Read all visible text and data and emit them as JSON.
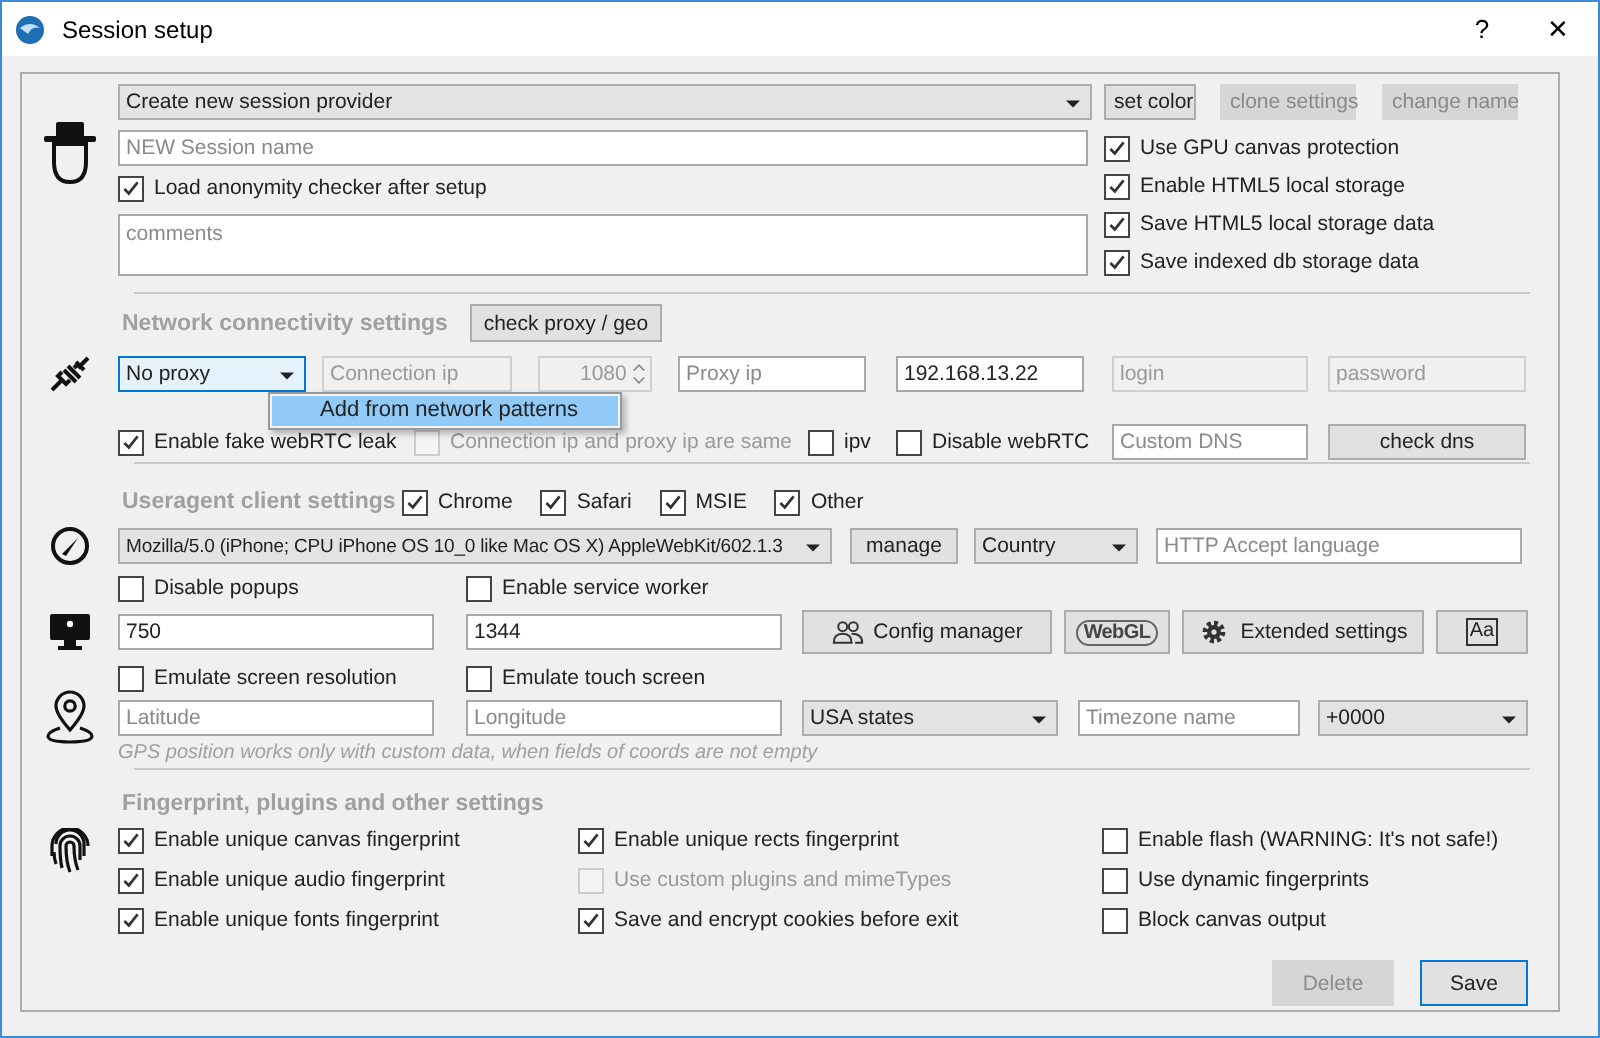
{
  "window": {
    "title": "Session setup",
    "help": "?",
    "close": "✕"
  },
  "session": {
    "provider": {
      "value": "Create new session provider"
    },
    "buttons": [
      {
        "label": "set color",
        "disabled": false
      },
      {
        "label": "clone settings",
        "disabled": true
      },
      {
        "label": "change name",
        "disabled": true
      }
    ],
    "name_field": {
      "placeholder": "NEW Session name"
    },
    "load_checker": {
      "label": "Load anonymity checker after setup",
      "checked": true
    },
    "comments": {
      "placeholder": "comments"
    },
    "options": [
      {
        "label": "Use GPU canvas protection",
        "checked": true
      },
      {
        "label": "Enable HTML5 local storage",
        "checked": true
      },
      {
        "label": "Save HTML5 local storage data",
        "checked": true
      },
      {
        "label": "Save indexed db storage data",
        "checked": true
      }
    ]
  },
  "network": {
    "title": "Network connectivity settings",
    "check_button": "check proxy / geo",
    "proxy_type": {
      "value": "No proxy"
    },
    "menu": [
      {
        "label": "Add from network patterns",
        "selected": true
      }
    ],
    "connection_ip": {
      "placeholder": "Connection ip",
      "disabled": true
    },
    "port": {
      "value": "1080",
      "disabled": true
    },
    "proxy_ip": {
      "placeholder": "Proxy ip"
    },
    "local_ip": {
      "value": "192.168.13.22"
    },
    "login": {
      "placeholder": "login",
      "disabled": true
    },
    "password": {
      "placeholder": "password",
      "disabled": true
    },
    "checks": [
      {
        "label": "Enable fake webRTC leak",
        "checked": true,
        "disabled": false
      },
      {
        "label": "Connection ip and proxy ip are same",
        "checked": false,
        "disabled": true
      },
      {
        "label": "ipv",
        "checked": false,
        "disabled": false
      },
      {
        "label": "Disable webRTC",
        "checked": false,
        "disabled": false
      }
    ],
    "dns": {
      "placeholder": "Custom DNS"
    },
    "check_dns": "check dns"
  },
  "useragent": {
    "title": "Useragent client settings",
    "browsers": [
      {
        "label": "Chrome",
        "checked": true
      },
      {
        "label": "Safari",
        "checked": true
      },
      {
        "label": "MSIE",
        "checked": true
      },
      {
        "label": "Other",
        "checked": true
      }
    ],
    "ua": {
      "value": "Mozilla/5.0 (iPhone; CPU iPhone OS 10_0 like Mac OS X) AppleWebKit/602.1.3"
    },
    "manage": "manage",
    "country": {
      "value": "Country"
    },
    "accept_language": {
      "placeholder": "HTTP Accept language"
    },
    "row_checks": [
      {
        "label": "Disable popups",
        "checked": false
      },
      {
        "label": "Enable service worker",
        "checked": false
      }
    ],
    "width": {
      "value": "750"
    },
    "height": {
      "value": "1344"
    },
    "tools": [
      {
        "kind": "people",
        "label": "Config manager"
      },
      {
        "kind": "webgl",
        "label": "WebGL"
      },
      {
        "kind": "gear",
        "label": "Extended settings"
      },
      {
        "kind": "font",
        "label": "Aa"
      }
    ],
    "emulation": [
      {
        "label": "Emulate screen resolution",
        "checked": false
      },
      {
        "label": "Emulate touch screen",
        "checked": false
      }
    ]
  },
  "geo": {
    "latitude": {
      "placeholder": "Latitude"
    },
    "longitude": {
      "placeholder": "Longitude"
    },
    "region": {
      "value": "USA states"
    },
    "timezone": {
      "placeholder": "Timezone name"
    },
    "offset": {
      "value": "+0000"
    },
    "note": "GPS position works only with custom data, when fields of coords are not empty"
  },
  "fingerprint": {
    "title": "Fingerprint, plugins and other settings",
    "columns": [
      [
        {
          "label": "Enable unique canvas fingerprint",
          "checked": true,
          "disabled": false
        },
        {
          "label": "Enable unique audio fingerprint",
          "checked": true,
          "disabled": false
        },
        {
          "label": "Enable unique fonts fingerprint",
          "checked": true,
          "disabled": false
        }
      ],
      [
        {
          "label": "Enable unique rects fingerprint",
          "checked": true,
          "disabled": false
        },
        {
          "label": "Use custom plugins and mimeTypes",
          "checked": false,
          "disabled": true
        },
        {
          "label": "Save and encrypt cookies before exit",
          "checked": true,
          "disabled": false
        }
      ],
      [
        {
          "label": "Enable flash (WARNING: It's not safe!)",
          "checked": false,
          "disabled": false
        },
        {
          "label": "Use dynamic fingerprints",
          "checked": false,
          "disabled": false
        },
        {
          "label": "Block canvas output",
          "checked": false,
          "disabled": false
        }
      ]
    ]
  },
  "footer": [
    {
      "label": "Delete",
      "disabled": true,
      "default": false
    },
    {
      "label": "Save",
      "disabled": false,
      "default": true
    }
  ]
}
